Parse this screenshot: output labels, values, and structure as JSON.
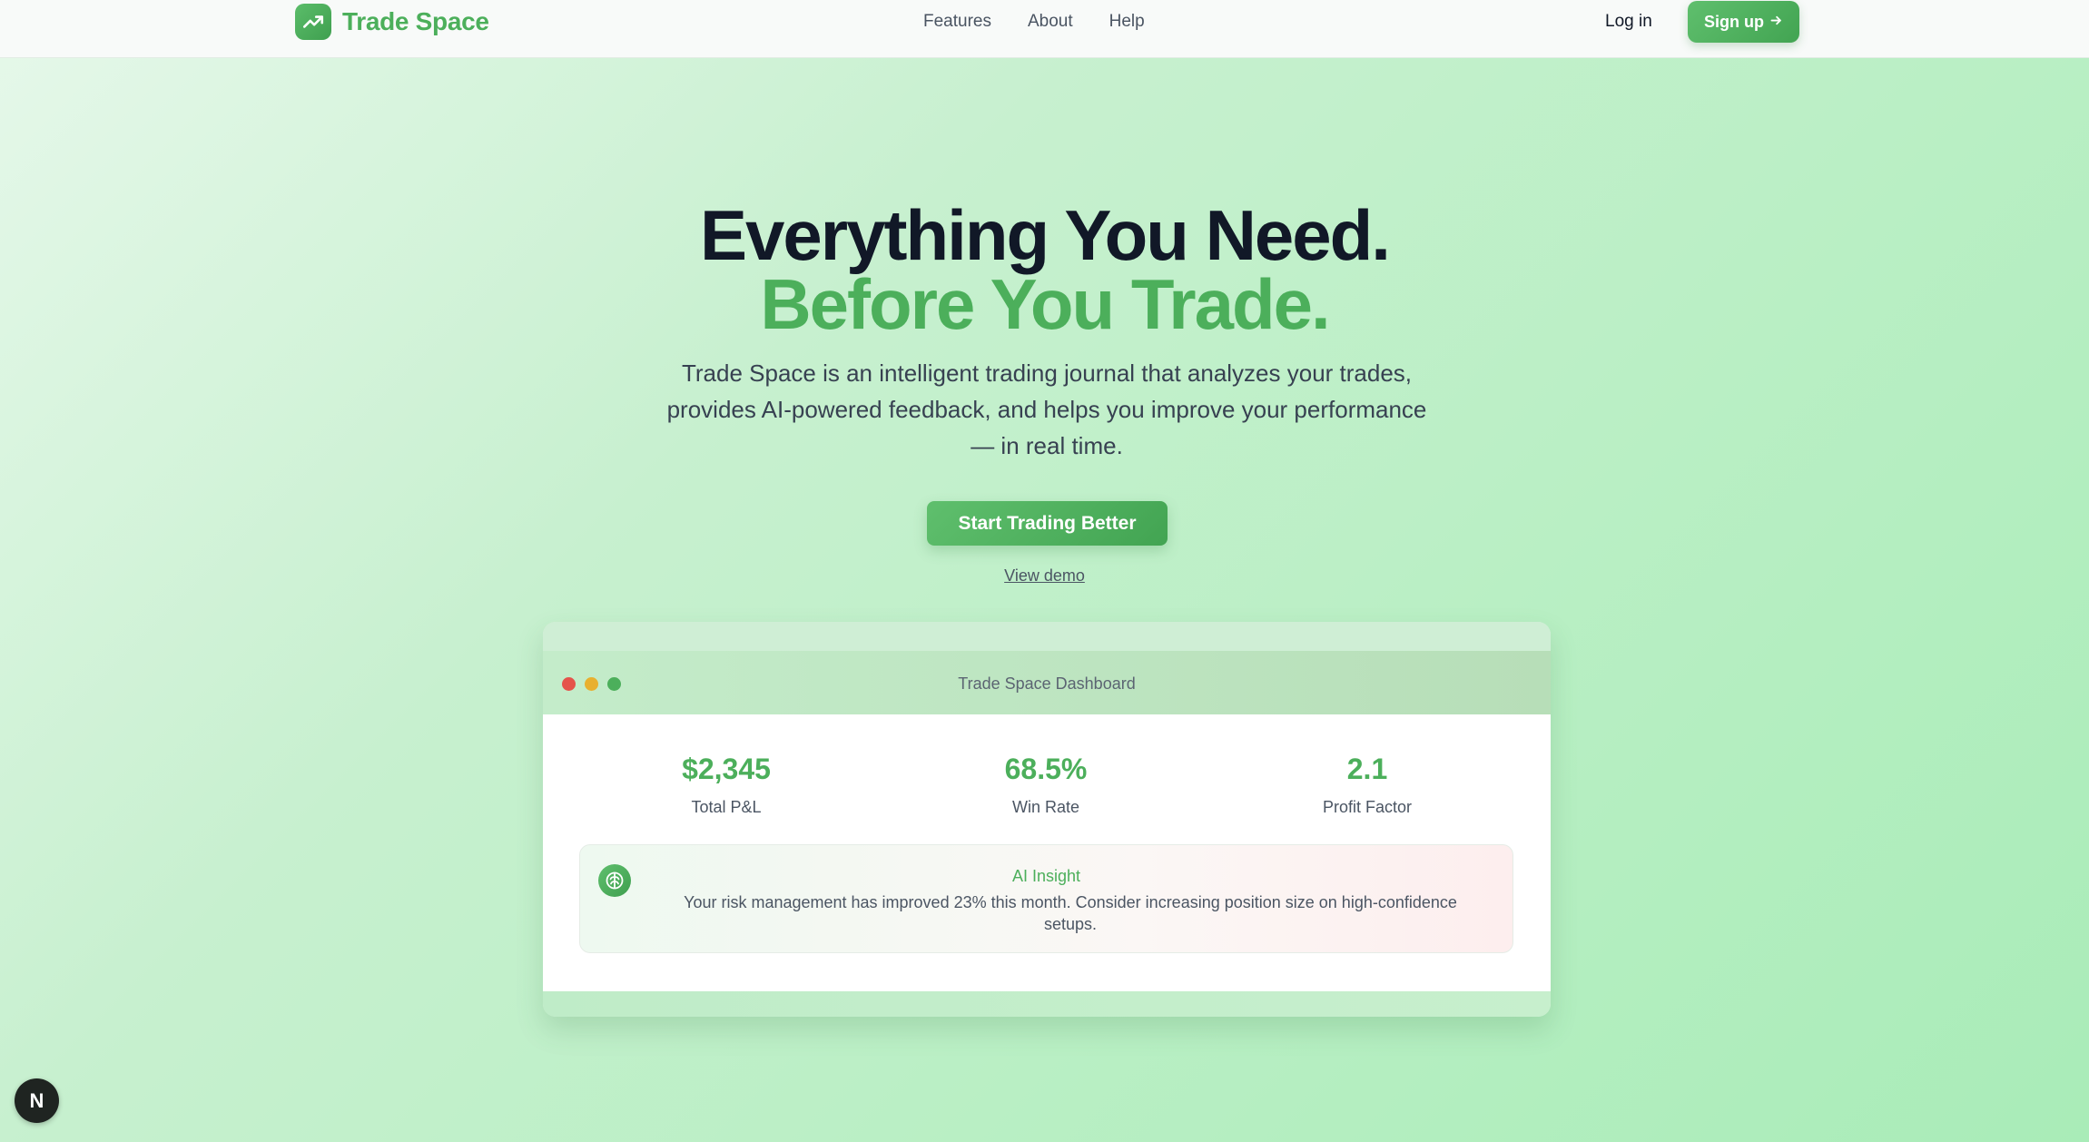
{
  "nav": {
    "brand": "Trade Space",
    "links": [
      "Features",
      "About",
      "Help"
    ],
    "login": "Log in",
    "signup": "Sign up",
    "signup_icon": "arrow-right-icon",
    "logo_icon": "trending-up-icon"
  },
  "hero": {
    "headline": "Everything You Need.",
    "headline_accent": "Before You Trade.",
    "subtitle": "Trade Space is an intelligent trading journal that analyzes your trades, provides AI-powered feedback, and helps you improve your performance — in real time.",
    "cta": "Start Trading Better",
    "secondary_link": "View demo"
  },
  "dashboard": {
    "window_title": "Trade Space Dashboard",
    "stats": [
      {
        "value": "$2,345",
        "label": "Total P&L"
      },
      {
        "value": "68.5%",
        "label": "Win Rate"
      },
      {
        "value": "2.1",
        "label": "Profit Factor"
      }
    ],
    "insight": {
      "icon": "brain-icon",
      "title": "AI Insight",
      "text": "Your risk management has improved 23% this month. Consider increasing position size on high-confidence setups."
    }
  },
  "badge": {
    "letter": "N"
  },
  "colors": {
    "accent": "#4caf5b",
    "heading": "#111827",
    "window_dot_red": "#e5534b",
    "window_dot_yellow": "#e8b02f",
    "window_dot_green": "#4caf5b"
  }
}
